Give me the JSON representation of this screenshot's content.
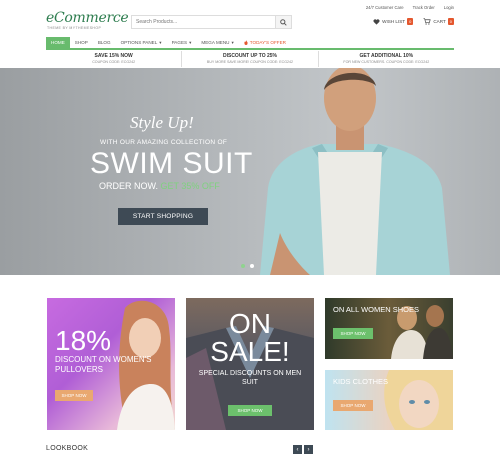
{
  "brand": {
    "logo": "eCommerce",
    "tagline": "THEME BY MYTHEMESHOP"
  },
  "search": {
    "placeholder": "Search Products..."
  },
  "top_links": [
    "24/7 Customer Care",
    "Track Order",
    "Login"
  ],
  "header": {
    "wishlist_label": "WISH LIST",
    "wishlist_count": "0",
    "cart_label": "CART",
    "cart_count": "0"
  },
  "nav": [
    {
      "label": "HOME",
      "active": true
    },
    {
      "label": "SHOP"
    },
    {
      "label": "BLOG"
    },
    {
      "label": "OPTIONS PANEL",
      "caret": "▾"
    },
    {
      "label": "PAGES",
      "caret": "▾"
    },
    {
      "label": "MEGA MENU",
      "caret": "▾"
    },
    {
      "label": "TODAY'S OFFER",
      "offer": true
    }
  ],
  "offers": [
    {
      "title": "SAVE 15% NOW",
      "sub": "COUPON CODE: ECG242"
    },
    {
      "title": "DISCOUNT UP TO 25%",
      "sub": "BUY MORE SAVE MORE! COUPON CODE: ECG242"
    },
    {
      "title": "GET ADDITIONAL 10%",
      "sub": "FOR NEW CUSTOMERS. COUPON CODE: ECG242"
    }
  ],
  "hero": {
    "style_up": "Style Up!",
    "lead": "WITH OUR AMAZING COLLECTION OF",
    "headline": "SWIM SUIT",
    "order": "ORDER NOW.",
    "order_offer": "GET 35% OFF",
    "cta": "START SHOPPING"
  },
  "promos": {
    "women_pullovers": {
      "percent": "18%",
      "text": "DISCOUNT ON WOMEN'S PULLOVERS",
      "button": "SHOP NOW"
    },
    "on_sale": {
      "title": "ON SALE!",
      "text": "SPECIAL DISCOUNTS ON MEN SUIT",
      "button": "SHOP NOW"
    },
    "women_shoes": {
      "text": "ON ALL WOMEN SHOES",
      "button": "SHOP NOW"
    },
    "kids_clothes": {
      "text": "KIDS CLOTHES",
      "button": "SHOP NOW"
    }
  },
  "lookbook": {
    "title": "LOOKBOOK",
    "prev": "‹",
    "next": "›"
  },
  "colors": {
    "accent_green": "#68bb6d",
    "offer_orange": "#e4572e",
    "dark_button": "#3e4a55"
  }
}
